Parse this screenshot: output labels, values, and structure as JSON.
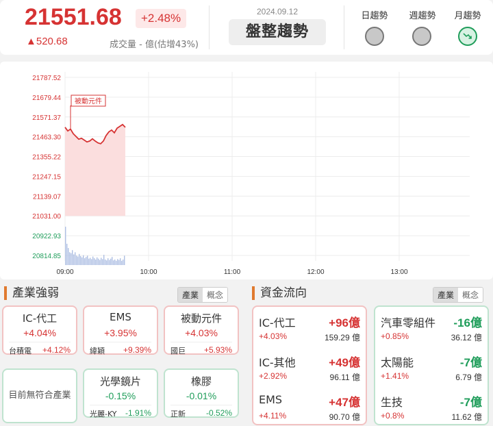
{
  "header": {
    "price": "21551.68",
    "pct_change": "+2.48%",
    "change": "▲520.68",
    "volume_text": "成交量 - 億(估增43%)",
    "date": "2024.09.12",
    "trend_state": "盤整趨勢",
    "trends": [
      {
        "label": "日趨勢",
        "state": "neutral"
      },
      {
        "label": "週趨勢",
        "state": "neutral"
      },
      {
        "label": "月趨勢",
        "state": "down"
      }
    ]
  },
  "chart_data": {
    "type": "line",
    "y_ticks": [
      "21787.52",
      "21679.44",
      "21571.37",
      "21463.30",
      "21355.22",
      "21247.15",
      "21139.07",
      "21031.00",
      "20922.93",
      "20814.85"
    ],
    "x_ticks": [
      "09:00",
      "10:00",
      "11:00",
      "12:00",
      "13:00"
    ],
    "ylim": [
      20814.85,
      21787.52
    ],
    "xlim_minutes": [
      0,
      270
    ],
    "base_value": 21031.0,
    "annotation": "被動元件",
    "price_series": {
      "minutes": [
        0,
        2,
        4,
        6,
        8,
        10,
        12,
        14,
        16,
        18,
        20,
        22,
        24,
        26,
        28,
        30,
        32,
        34,
        36,
        38,
        40,
        42,
        44
      ],
      "values": [
        21515,
        21495,
        21505,
        21480,
        21465,
        21450,
        21455,
        21445,
        21435,
        21440,
        21452,
        21440,
        21430,
        21425,
        21440,
        21470,
        21490,
        21500,
        21485,
        21510,
        21520,
        21530,
        21515
      ]
    },
    "volume_bars": [
      9,
      5,
      4,
      3,
      2.8,
      3.5,
      2.5,
      3,
      2.2,
      2,
      2.6,
      2.1,
      1.8,
      2.3,
      1.6,
      1.9,
      2.2,
      1.5,
      1.7,
      1.4,
      2,
      1.6,
      1.3,
      1.8,
      1.5,
      1.2,
      1.7,
      1.4,
      2.4,
      1.3,
      1.1,
      1.6,
      1.2,
      1.5,
      1.9,
      1.1,
      1.3,
      1.0,
      1.4,
      1.2,
      1.6,
      1.0,
      1.3,
      2.2
    ]
  },
  "industry": {
    "title": "產業強弱",
    "tabs": [
      "產業",
      "概念"
    ],
    "cards": [
      {
        "name": "IC-代工",
        "pct": "+4.04%",
        "stock": "台積電",
        "stock_pct": "+4.12%",
        "dir": "up"
      },
      {
        "name": "EMS",
        "pct": "+3.95%",
        "stock": "緯穎",
        "stock_pct": "+9.39%",
        "dir": "up"
      },
      {
        "name": "被動元件",
        "pct": "+4.03%",
        "stock": "國巨",
        "stock_pct": "+5.93%",
        "dir": "up"
      },
      {
        "name": "光學鏡片",
        "pct": "-0.15%",
        "stock": "光麗-KY",
        "stock_pct": "-1.91%",
        "dir": "down"
      },
      {
        "name": "橡膠",
        "pct": "-0.01%",
        "stock": "正新",
        "stock_pct": "-0.52%",
        "dir": "down"
      }
    ],
    "empty_text": "目前無符合產業"
  },
  "flow": {
    "title": "資金流向",
    "tabs": [
      "產業",
      "概念"
    ],
    "inflow": [
      {
        "name": "IC-代工",
        "amount": "+96億",
        "pct": "+4.03%",
        "vol": "159.29 億"
      },
      {
        "name": "IC-其他",
        "amount": "+49億",
        "pct": "+2.92%",
        "vol": "96.11 億"
      },
      {
        "name": "EMS",
        "amount": "+47億",
        "pct": "+4.11%",
        "vol": "90.70 億"
      }
    ],
    "outflow": [
      {
        "name": "汽車零組件",
        "amount": "-16億",
        "pct": "+0.85%",
        "vol": "36.12 億"
      },
      {
        "name": "太陽能",
        "amount": "-7億",
        "pct": "+1.41%",
        "vol": "6.79 億"
      },
      {
        "name": "生技",
        "amount": "-7億",
        "pct": "+0.8%",
        "vol": "11.62 億"
      }
    ]
  }
}
